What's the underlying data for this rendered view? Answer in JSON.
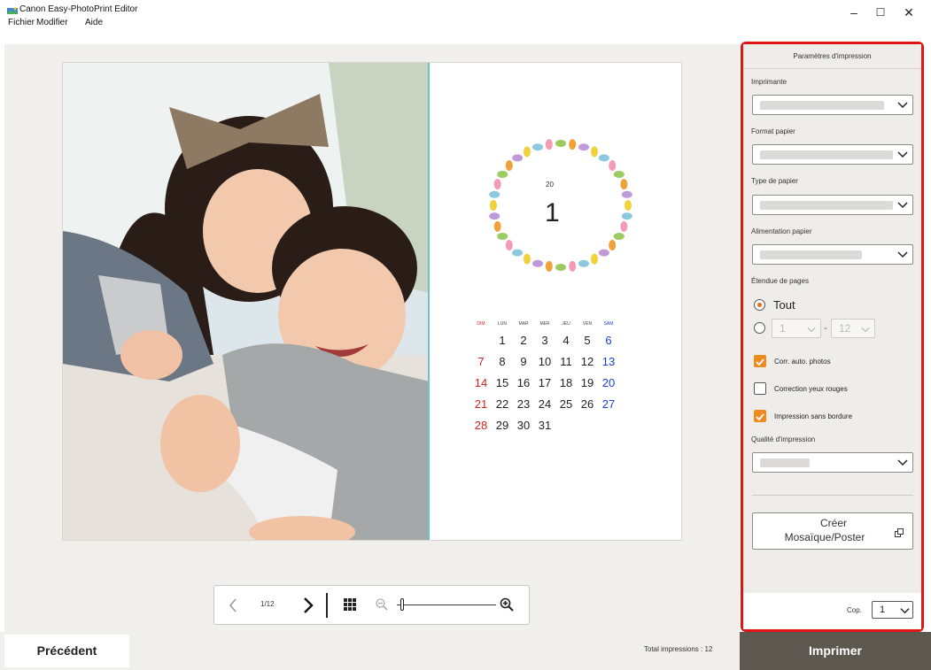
{
  "window": {
    "title": "Canon Easy-PhotoPrint Editor",
    "minimize": "–",
    "maximize": "☐",
    "close": "✕"
  },
  "menu": [
    "Fichier",
    "Modifier",
    "Aide"
  ],
  "calendar": {
    "year": "20",
    "month": "1",
    "weekdays": [
      "DIM",
      "LUN",
      "MAR",
      "MER",
      "JEU",
      "VEN",
      "SAM"
    ],
    "weeks": [
      [
        "",
        "1",
        "2",
        "3",
        "4",
        "5",
        "6"
      ],
      [
        "7",
        "8",
        "9",
        "10",
        "11",
        "12",
        "13"
      ],
      [
        "14",
        "15",
        "16",
        "17",
        "18",
        "19",
        "20"
      ],
      [
        "21",
        "22",
        "23",
        "24",
        "25",
        "26",
        "27"
      ],
      [
        "28",
        "29",
        "30",
        "31",
        "",
        "",
        ""
      ]
    ],
    "colors": {
      "sunday": "#d12424",
      "saturday": "#2040d0"
    }
  },
  "navigation": {
    "page_indicator": "1/12",
    "zoom_level": 0.04
  },
  "footer": {
    "previous_label": "Précédent",
    "total_impressions": "Total impressions : 12",
    "print_label": "Imprimer"
  },
  "settings": {
    "title": "Paramètres d'impression",
    "printer_label": "Imprimante",
    "paper_size_label": "Format papier",
    "paper_type_label": "Type de papier",
    "paper_source_label": "Alimentation papier",
    "page_range_label": "Étendue de pages",
    "page_range_all": "Tout",
    "page_range_from": "1",
    "page_range_separator": "-",
    "page_range_to": "12",
    "auto_photo_fix_label": "Corr. auto. photos",
    "auto_photo_fix_checked": true,
    "red_eye_label": "Correction yeux rouges",
    "red_eye_checked": false,
    "borderless_label": "Impression sans bordure",
    "borderless_checked": true,
    "quality_label": "Qualité d'impression",
    "mosaic_line1": "Créer",
    "mosaic_line2": "Mosaïque/Poster",
    "copies_label": "Cop.",
    "copies_value": "1"
  },
  "accent_colors": {
    "highlight_border": "#e01616",
    "checkbox": "#ef8a1f",
    "print_button": "#5c574f"
  }
}
